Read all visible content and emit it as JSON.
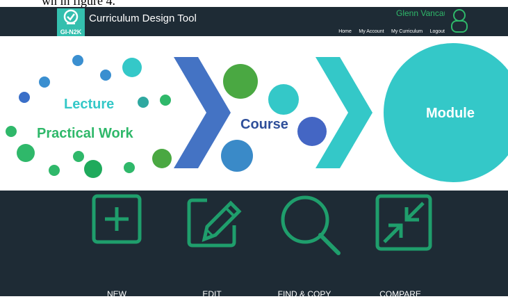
{
  "page_fragment": "wn in figure 4.",
  "header": {
    "logo_text": "GI-N2K",
    "app_title": "Curriculum Design Tool",
    "user_name": "Glenn Vancauwenberghe",
    "nav": [
      "Home",
      "My Account",
      "My Curriculum",
      "Logout"
    ]
  },
  "hero": {
    "lecture": "Lecture",
    "practical": "Practical Work",
    "course": "Course",
    "module": "Module"
  },
  "tools": [
    {
      "label": "NEW"
    },
    {
      "label": "EDIT"
    },
    {
      "label": "FIND & COPY"
    },
    {
      "label": "COMPARE"
    }
  ],
  "colors": {
    "header_bg": "#1e2b35",
    "teal": "#34c8c8",
    "green": "#2fb86a",
    "blue": "#4473c4",
    "icon_green": "#1f9e6c"
  }
}
